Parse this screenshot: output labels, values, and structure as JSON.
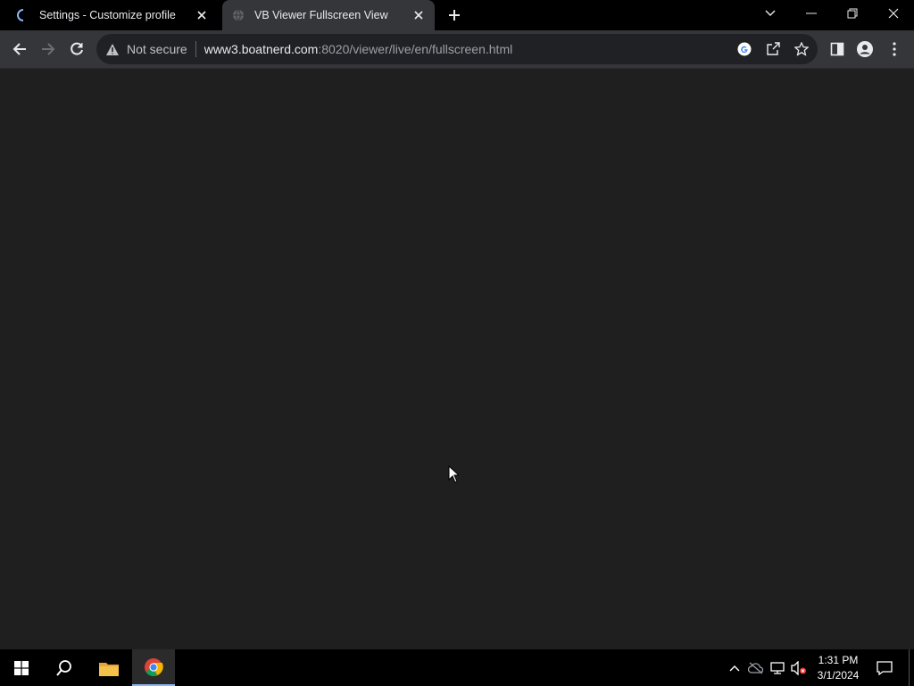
{
  "tabs": [
    {
      "title": "Settings - Customize profile",
      "state": "loading",
      "active": false
    },
    {
      "title": "VB Viewer Fullscreen View",
      "state": "loaded",
      "active": true
    }
  ],
  "toolbar": {
    "security_label": "Not secure",
    "url_host": "www3.boatnerd.com",
    "url_rest": ":8020/viewer/live/en/fullscreen.html"
  },
  "icons": {
    "back": "arrow-left-icon",
    "forward": "arrow-right-icon",
    "reload": "reload-icon",
    "google": "google-icon",
    "share": "share-icon",
    "bookmark": "star-icon",
    "sidepanel": "side-panel-icon",
    "profile": "profile-icon",
    "menu": "kebab-menu-icon"
  },
  "taskbar": {
    "time": "1:31 PM",
    "date": "3/1/2024"
  },
  "colors": {
    "tabstrip": "#000000",
    "toolbar": "#35363a",
    "content": "#1f1f1f",
    "accent": "#8ab4f8"
  }
}
